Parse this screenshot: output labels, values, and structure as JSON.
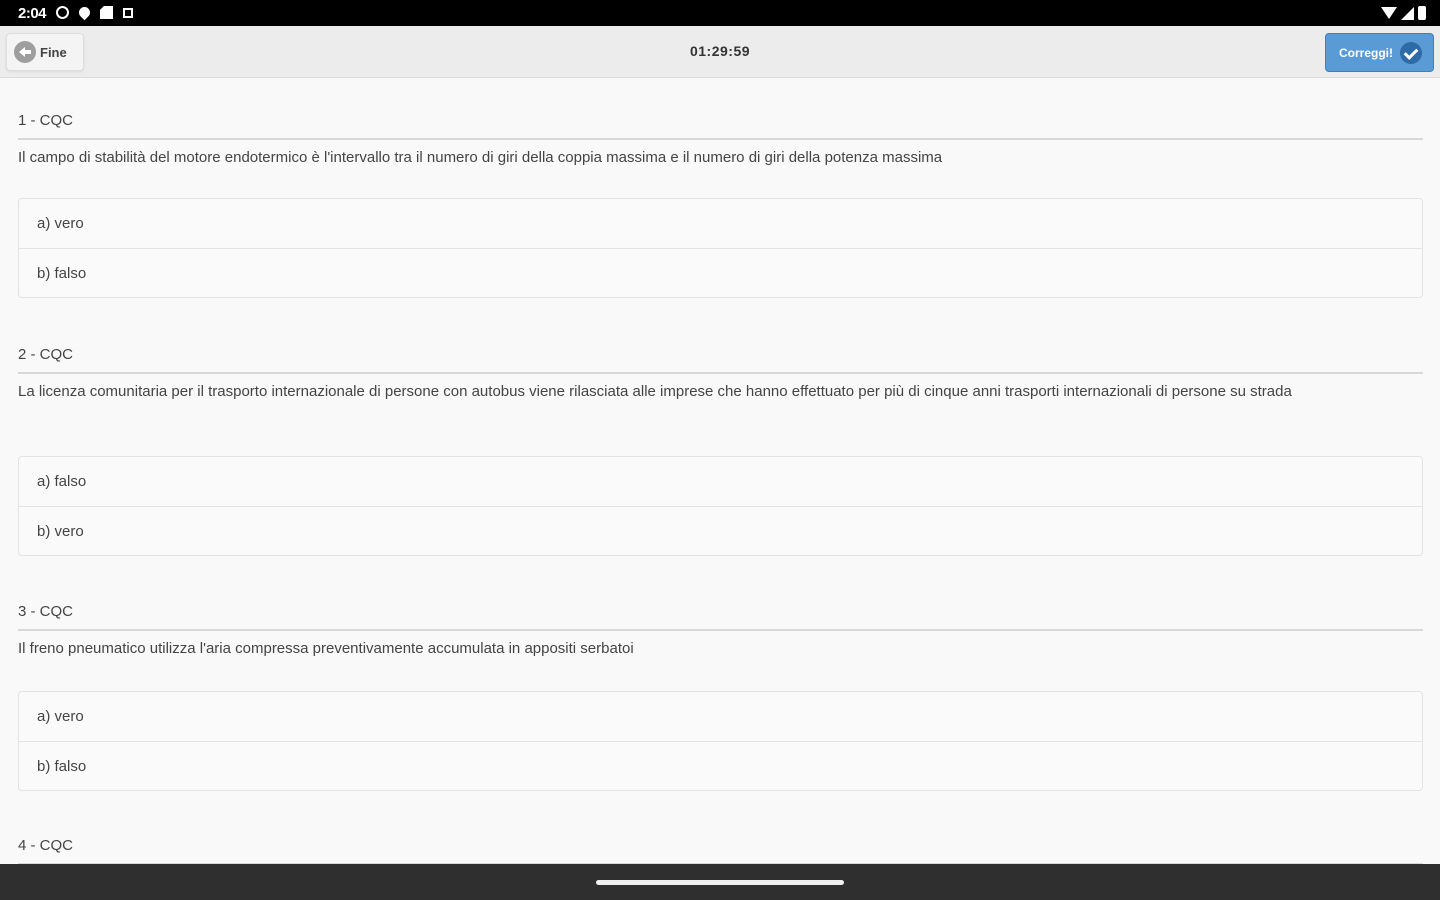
{
  "status_bar": {
    "time": "2:04",
    "left_icons": [
      "data-saver-icon",
      "location-pin-icon",
      "sd-card-icon",
      "notification-square-icon"
    ],
    "right_icons": [
      "wifi-icon",
      "signal-icon",
      "battery-icon"
    ]
  },
  "toolbar": {
    "back_label": "Fine",
    "timer": "01:29:59",
    "correct_label": "Correggi!",
    "accent_color": "#5b9bd5"
  },
  "questions": [
    {
      "header": "1 - CQC",
      "text": "Il campo di stabilità del motore endotermico è l'intervallo tra il numero di giri della coppia massima e il numero di giri della potenza massima",
      "answers": [
        "a) vero",
        "b) falso"
      ]
    },
    {
      "header": "2 - CQC",
      "text": "La licenza comunitaria per il trasporto internazionale di persone con autobus viene rilasciata alle imprese che hanno effettuato per più di cinque anni trasporti internazionali di persone su strada",
      "answers": [
        "a) falso",
        "b) vero"
      ]
    },
    {
      "header": "3 - CQC",
      "text": "Il freno pneumatico utilizza l'aria compressa preventivamente accumulata in appositi serbatoi",
      "answers": [
        "a) vero",
        "b) falso"
      ]
    },
    {
      "header": "4 - CQC"
    }
  ]
}
